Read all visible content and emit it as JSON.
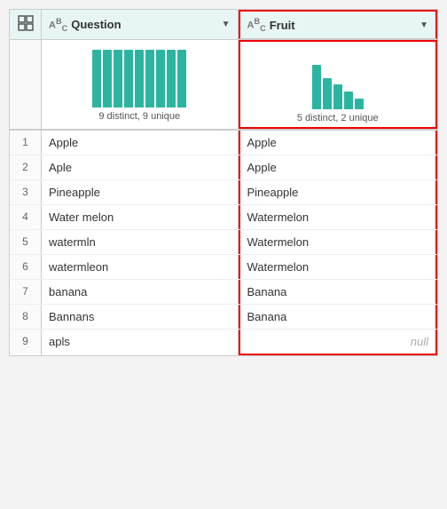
{
  "columns": {
    "question": {
      "icon": "ABC",
      "label": "Question",
      "profile_text": "9 distinct, 9 unique",
      "bars": [
        65,
        65,
        65,
        65,
        65,
        65,
        65,
        65,
        65
      ]
    },
    "fruit": {
      "icon": "ABC",
      "label": "Fruit",
      "profile_text": "5 distinct, 2 unique",
      "bars": [
        50,
        35,
        28,
        20,
        12
      ]
    }
  },
  "rows": [
    {
      "num": "1",
      "question": "Apple",
      "fruit": "Apple",
      "null": false
    },
    {
      "num": "2",
      "question": "Aple",
      "fruit": "Apple",
      "null": false
    },
    {
      "num": "3",
      "question": "Pineapple",
      "fruit": "Pineapple",
      "null": false
    },
    {
      "num": "4",
      "question": "Water melon",
      "fruit": "Watermelon",
      "null": false
    },
    {
      "num": "5",
      "question": "watermln",
      "fruit": "Watermelon",
      "null": false
    },
    {
      "num": "6",
      "question": "watermleon",
      "fruit": "Watermelon",
      "null": false
    },
    {
      "num": "7",
      "question": "banana",
      "fruit": "Banana",
      "null": false
    },
    {
      "num": "8",
      "question": "Bannans",
      "fruit": "Banana",
      "null": false
    },
    {
      "num": "9",
      "question": "apls",
      "fruit": null,
      "null": true
    }
  ],
  "labels": {
    "null_label": "null"
  }
}
